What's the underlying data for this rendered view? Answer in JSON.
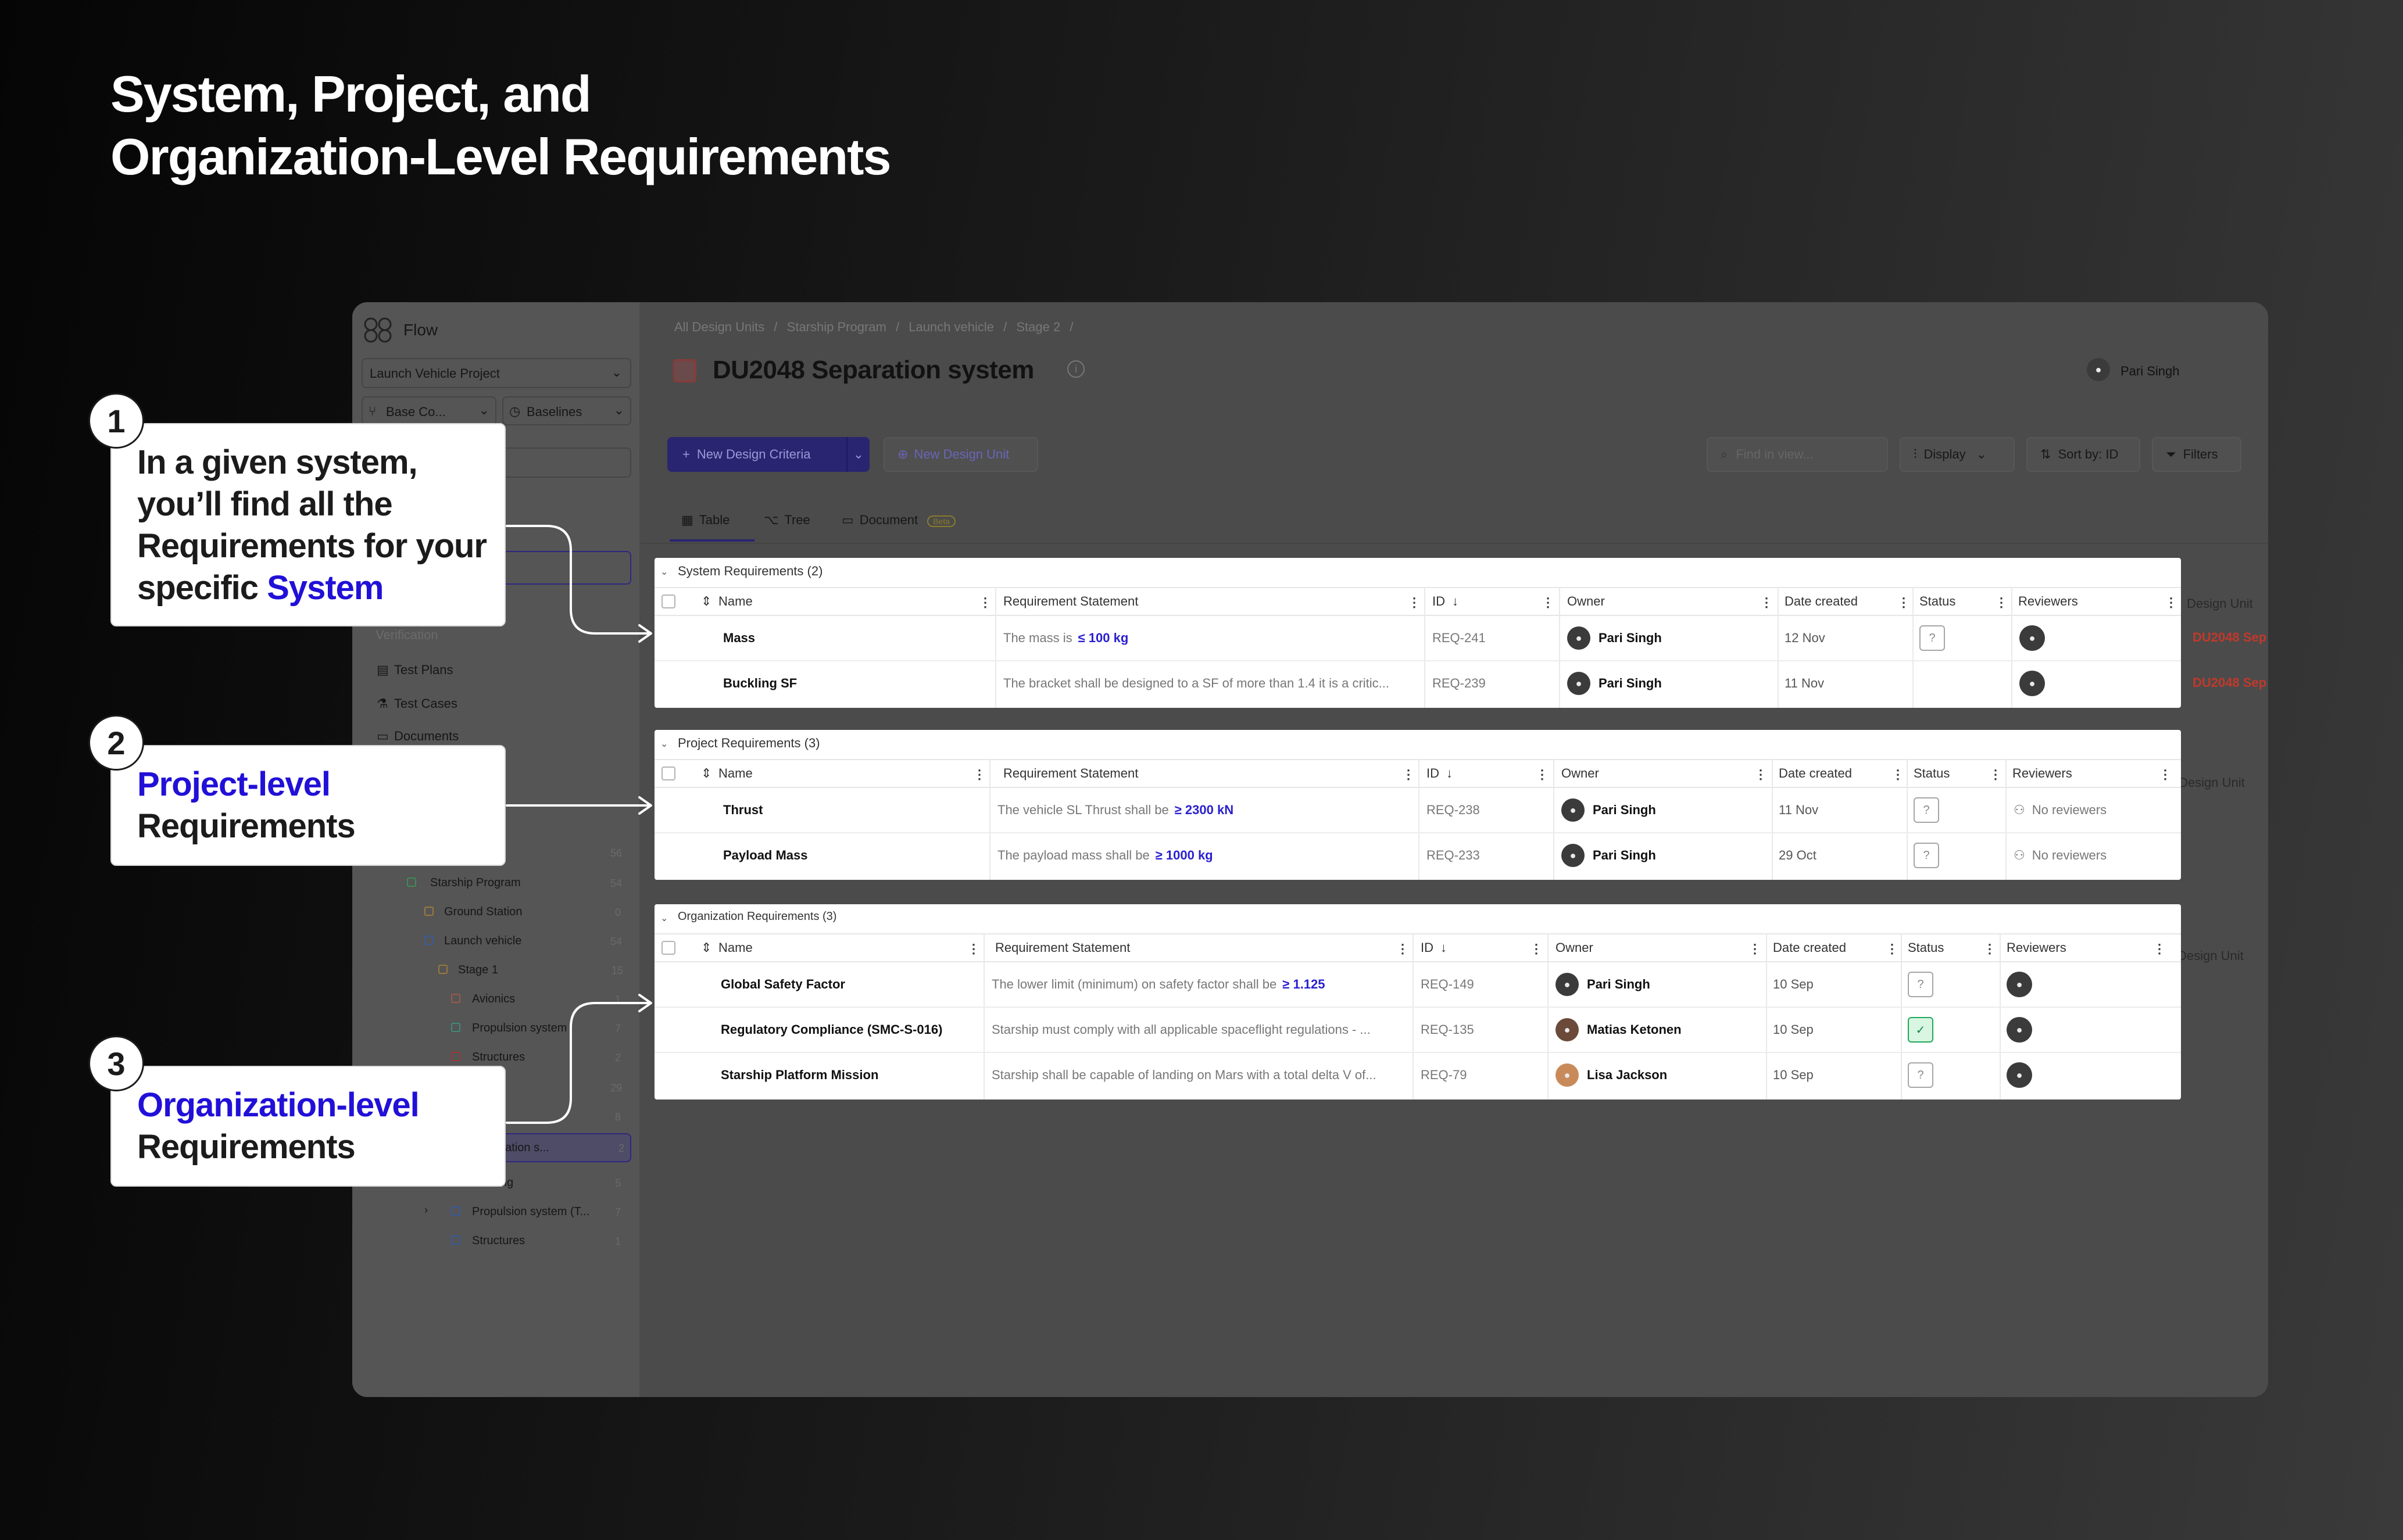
{
  "headline": {
    "line1": "System, Project, and",
    "line2": "Organization-Level Requirements"
  },
  "app": {
    "brand": "Flow",
    "project_selector": "Launch Vehicle Project",
    "base_config_button": "Base Co...",
    "baselines_button": "Baselines",
    "breadcrumb": [
      "All Design Units",
      "Starship Program",
      "Launch vehicle",
      "Stage 2"
    ],
    "breadcrumb_sep": "/",
    "page_title": "DU2048 Separation system",
    "user_name": "Pari Singh",
    "toolbar": {
      "new_design_criteria": "New Design Criteria",
      "new_design_unit": "New Design Unit",
      "search_placeholder": "Find in view...",
      "display": "Display",
      "sort": "Sort by: ID",
      "filters": "Filters"
    },
    "tabs": {
      "table": "Table",
      "tree": "Tree",
      "document": "Document",
      "document_badge": "Beta"
    }
  },
  "sidebar": {
    "section_verification": "Verification",
    "verification_items": [
      "Test Plans",
      "Test Cases",
      "Documents"
    ],
    "tree": [
      {
        "label": "Starship Program",
        "count": "54"
      },
      {
        "label": "Ground Station",
        "count": "0"
      },
      {
        "label": "Launch vehicle",
        "count": "54"
      },
      {
        "label": "Stage 1",
        "count": "15"
      },
      {
        "label": "Avionics",
        "count": "1"
      },
      {
        "label": "Propulsion system",
        "count": "7"
      },
      {
        "label": "Structures",
        "count": "2"
      },
      {
        "label": "",
        "count": "29"
      },
      {
        "label": "",
        "count": "8"
      },
      {
        "label": "48 Separation s...",
        "count": "2"
      },
      {
        "label": "d fairing",
        "count": "5"
      },
      {
        "label": "Propulsion system (T...",
        "count": "7"
      },
      {
        "label": "Structures",
        "count": "1"
      }
    ],
    "extra_count": "56"
  },
  "columns": {
    "name": "Name",
    "statement": "Requirement Statement",
    "id": "ID",
    "owner": "Owner",
    "date": "Date created",
    "status": "Status",
    "reviewers": "Reviewers",
    "design_unit": "Design Unit"
  },
  "panels": [
    {
      "title": "System Requirements (2)",
      "rows": [
        {
          "name": "Mass",
          "statement": "The mass is",
          "value": "≤ 100 kg",
          "id": "REQ-241",
          "owner": "Pari Singh",
          "date": "12 Nov",
          "status": "?",
          "reviewer": "avatar",
          "design_unit": "DU2048 Sep"
        },
        {
          "name": "Buckling SF",
          "statement": "The bracket shall be designed to a SF of more than 1.4 it is a critic...",
          "value": "",
          "id": "REQ-239",
          "owner": "Pari Singh",
          "date": "11 Nov",
          "status": "",
          "reviewer": "avatar",
          "design_unit": "DU2048 Sep"
        }
      ]
    },
    {
      "title": "Project Requirements (3)",
      "rows": [
        {
          "name": "Thrust",
          "statement": "The vehicle SL Thrust shall be",
          "value": "≥ 2300 kN",
          "id": "REQ-238",
          "owner": "Pari Singh",
          "date": "11 Nov",
          "status": "?",
          "reviewer": "No reviewers"
        },
        {
          "name": "Payload Mass",
          "statement": "The payload mass shall be",
          "value": "≥ 1000 kg",
          "id": "REQ-233",
          "owner": "Pari Singh",
          "date": "29 Oct",
          "status": "?",
          "reviewer": "No reviewers"
        }
      ]
    },
    {
      "title": "Organization Requirements (3)",
      "rows": [
        {
          "name": "Global Safety Factor",
          "statement": "The lower limit (minimum) on safety factor shall be",
          "value": "≥ 1.125",
          "id": "REQ-149",
          "owner": "Pari Singh",
          "date": "10 Sep",
          "status": "?",
          "reviewer": "avatar"
        },
        {
          "name": "Regulatory Compliance (SMC-S-016)",
          "statement": "Starship must comply with all applicable spaceflight regulations - ...",
          "value": "",
          "id": "REQ-135",
          "owner": "Matias Ketonen",
          "date": "10 Sep",
          "status": "✓",
          "reviewer": "avatar"
        },
        {
          "name": "Starship Platform Mission",
          "statement": "Starship shall be capable of landing on Mars with a total delta V of...",
          "value": "",
          "id": "REQ-79",
          "owner": "Lisa Jackson",
          "date": "10 Sep",
          "status": "?",
          "reviewer": "avatar"
        }
      ]
    }
  ],
  "callouts": [
    {
      "number": "1",
      "lines": [
        "In a given system,",
        "you’ll find all the",
        "Requirements for your"
      ],
      "last_prefix": "specific ",
      "last_highlight": "System"
    },
    {
      "number": "2",
      "highlight": "Project-level",
      "rest": "Requirements"
    },
    {
      "number": "3",
      "highlight": "Organization-level",
      "rest": "Requirements"
    }
  ],
  "colors": {
    "accent_blue": "#2110d7",
    "value_blue": "#2a1fd0",
    "design_unit_red": "#c0392b",
    "status_ok": "#20a957"
  }
}
